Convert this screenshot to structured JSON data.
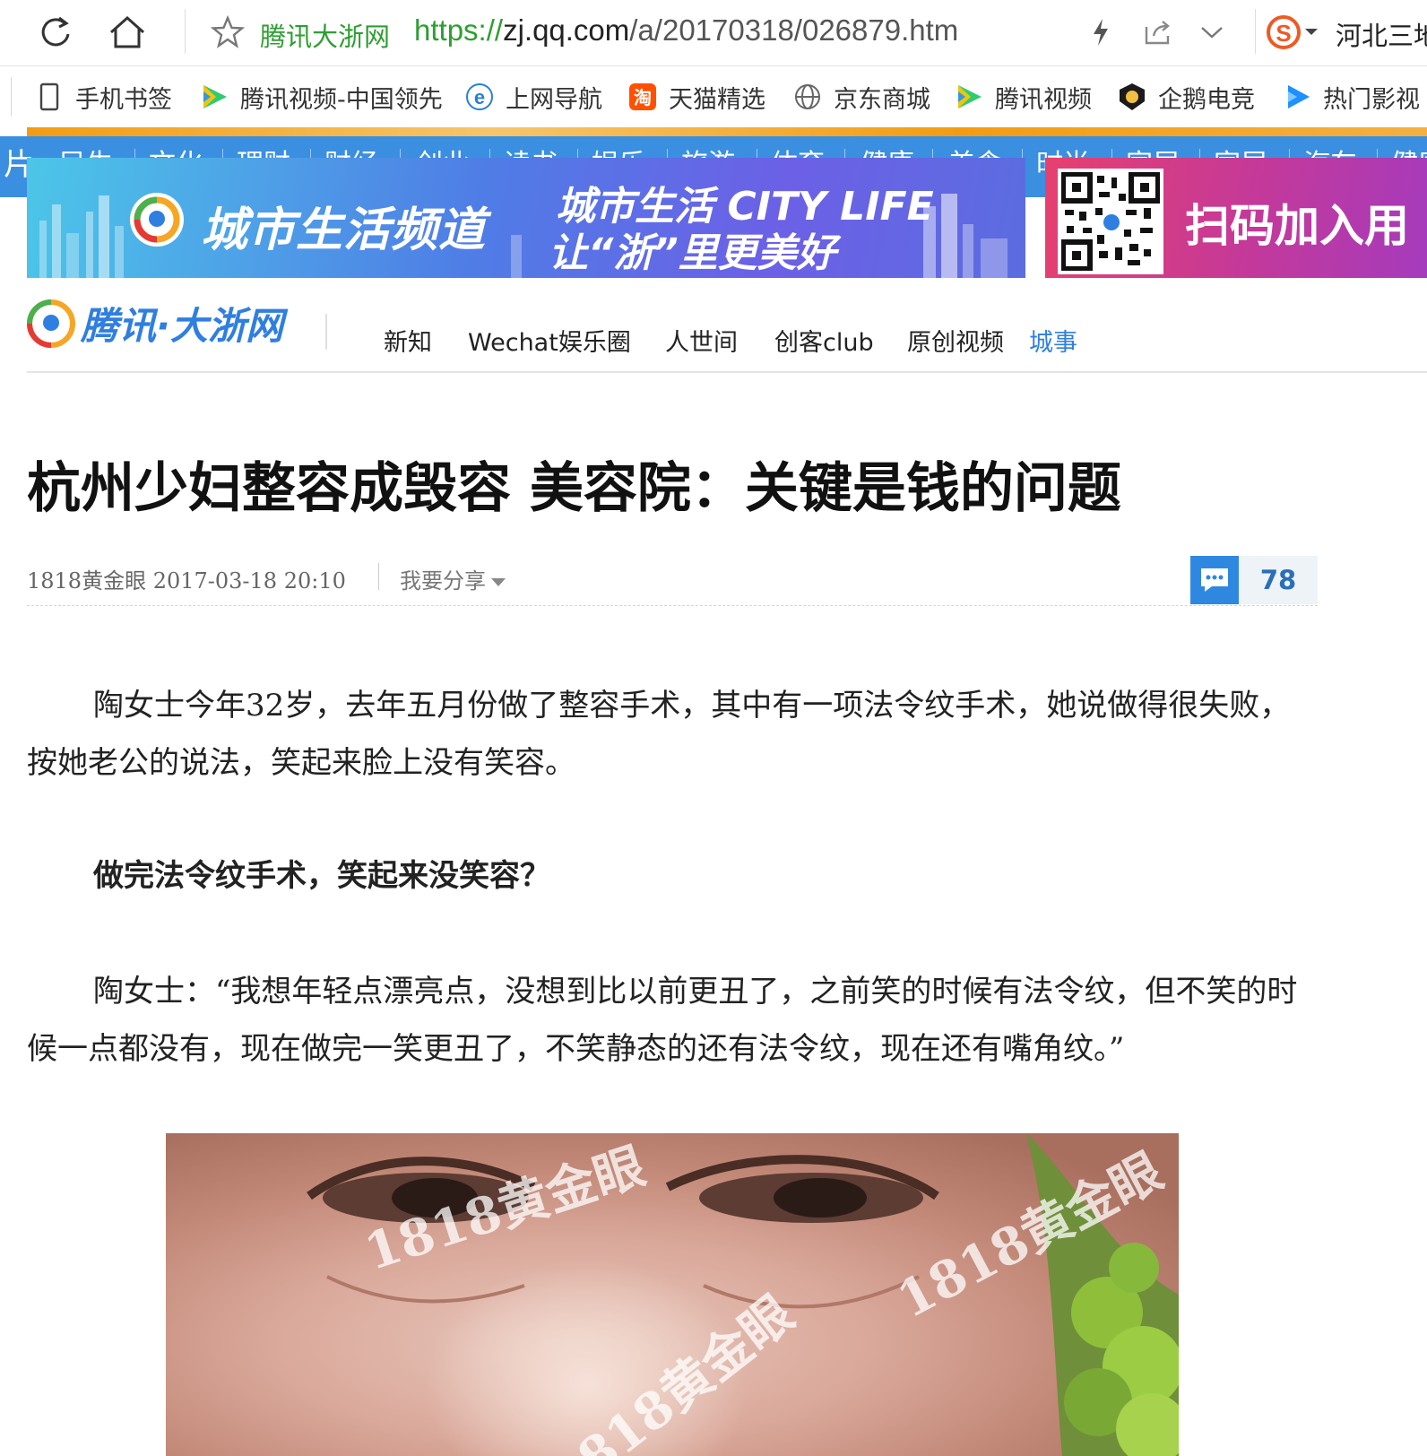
{
  "browser": {
    "site_name": "腾讯大浙网",
    "url_proto": "https://",
    "url_host": "zj.qq.com",
    "url_path": "/a/20170318/026879.htm",
    "search_text": "河北三地"
  },
  "bookmarks": [
    {
      "label": "手机书签",
      "icon": "phone-icon"
    },
    {
      "label": "腾讯视频-中国领先",
      "icon": "play-icon"
    },
    {
      "label": "上网导航",
      "icon": "ie-icon"
    },
    {
      "label": "天猫精选",
      "icon": "taobao-icon"
    },
    {
      "label": "京东商城",
      "icon": "globe-icon"
    },
    {
      "label": "腾讯视频",
      "icon": "play-icon"
    },
    {
      "label": "企鹅电竞",
      "icon": "esports-icon"
    },
    {
      "label": "热门影视",
      "icon": "video-icon"
    }
  ],
  "blue_nav": {
    "edge": "片",
    "items": [
      "民生",
      "文化",
      "理财",
      "财经",
      "创业",
      "读书",
      "娱乐",
      "旅游",
      "体育",
      "健康",
      "美食",
      "时尚",
      "家居",
      "家居",
      "汽车",
      "健康"
    ]
  },
  "banner": {
    "title": "城市生活频道",
    "slogan_line1": "城市生活 CITY LIFE",
    "slogan_line2": "让“浙”里更美好",
    "right_text": "扫码加入用"
  },
  "header": {
    "logo_text": "腾讯·大浙网",
    "nav": [
      "新知",
      "Wechat娱乐圈",
      "人世间",
      "创客club",
      "原创视频",
      "城事"
    ],
    "active_index": 5
  },
  "article": {
    "title": "杭州少妇整容成毁容 美容院：关键是钱的问题",
    "source_date": "1818黄金眼 2017-03-18 20:10",
    "share_label": "我要分享",
    "comment_count": "78",
    "paragraphs": [
      "陶女士今年32岁，去年五月份做了整容手术，其中有一项法令纹手术，她说做得很失败，按她老公的说法，笑起来脸上没有笑容。",
      "做完法令纹手术，笑起来没笑容？",
      "陶女士：“我想年轻点漂亮点，没想到比以前更丑了，之前笑的时候有法令纹，但不笑的时候一点都没有，现在做完一笑更丑了，不笑静态的还有法令纹，现在还有嘴角纹。”"
    ],
    "photo_watermark": "1818黄金眼"
  },
  "colors": {
    "accent_blue": "#2f7fe0",
    "site_green": "#2e9e32",
    "nav_blue": "#3b8fe0"
  }
}
